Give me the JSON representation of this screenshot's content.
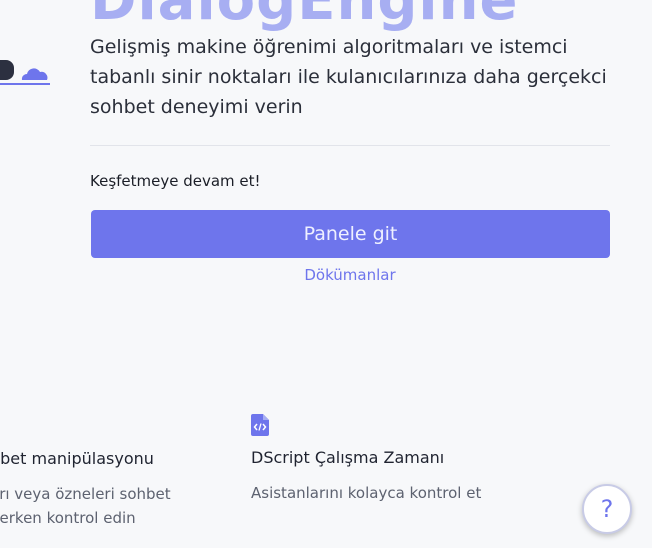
{
  "hero": {
    "title": "DialogEngine",
    "description": "Gelişmiş makine öğrenimi algoritmaları ve istemci tabanlı sinir noktaları ile kulanıcılarınıza daha gerçekci sohbet deneyimi verin"
  },
  "cta": {
    "explore_label": "Keşfetmeye devam et!",
    "panel_button": "Panele git",
    "docs_link": "Dökümanlar"
  },
  "features": [
    {
      "title": "hbet manipülasyonu",
      "desc_line1": "arı veya özneleri sohbet",
      "desc_line2": "derken kontrol edin"
    },
    {
      "icon": "code-file-icon",
      "title": "DScript Çalışma Zamanı",
      "desc_line1": "Asistanlarını kolayca kontrol et"
    }
  ],
  "help": {
    "label": "?"
  },
  "colors": {
    "accent": "#6e75ec",
    "background": "#f7f8fa",
    "title_faded": "#a7aef2"
  }
}
